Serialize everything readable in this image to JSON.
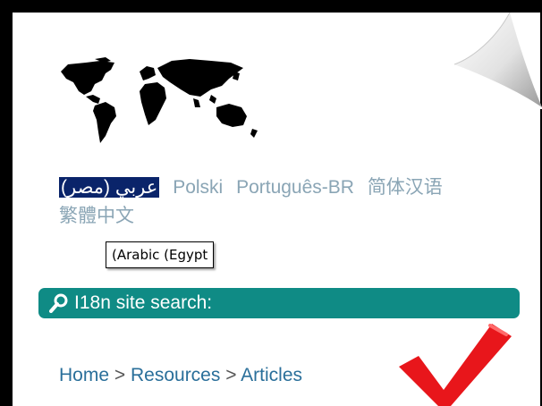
{
  "languages": [
    {
      "label": "عربي (مصر)",
      "selected": true
    },
    {
      "label": "Polski",
      "selected": false
    },
    {
      "label": "Português-BR",
      "selected": false
    },
    {
      "label": "简体汉语",
      "selected": false
    },
    {
      "label": "繁體中文",
      "selected": false
    }
  ],
  "tooltip": {
    "text": "(Arabic (Egypt"
  },
  "search": {
    "label": "I18n site search:",
    "icon": "magnifier-icon"
  },
  "breadcrumb": {
    "items": [
      "Home",
      "Resources",
      "Articles"
    ],
    "separator": ">"
  },
  "colors": {
    "background": "#000000",
    "page": "#ffffff",
    "search_bar": "#0f8b85",
    "language_link": "#8aa5b5",
    "selected_highlight": "#0a246a",
    "breadcrumb_link": "#2a6f9a",
    "checkmark": "#e8161b"
  }
}
